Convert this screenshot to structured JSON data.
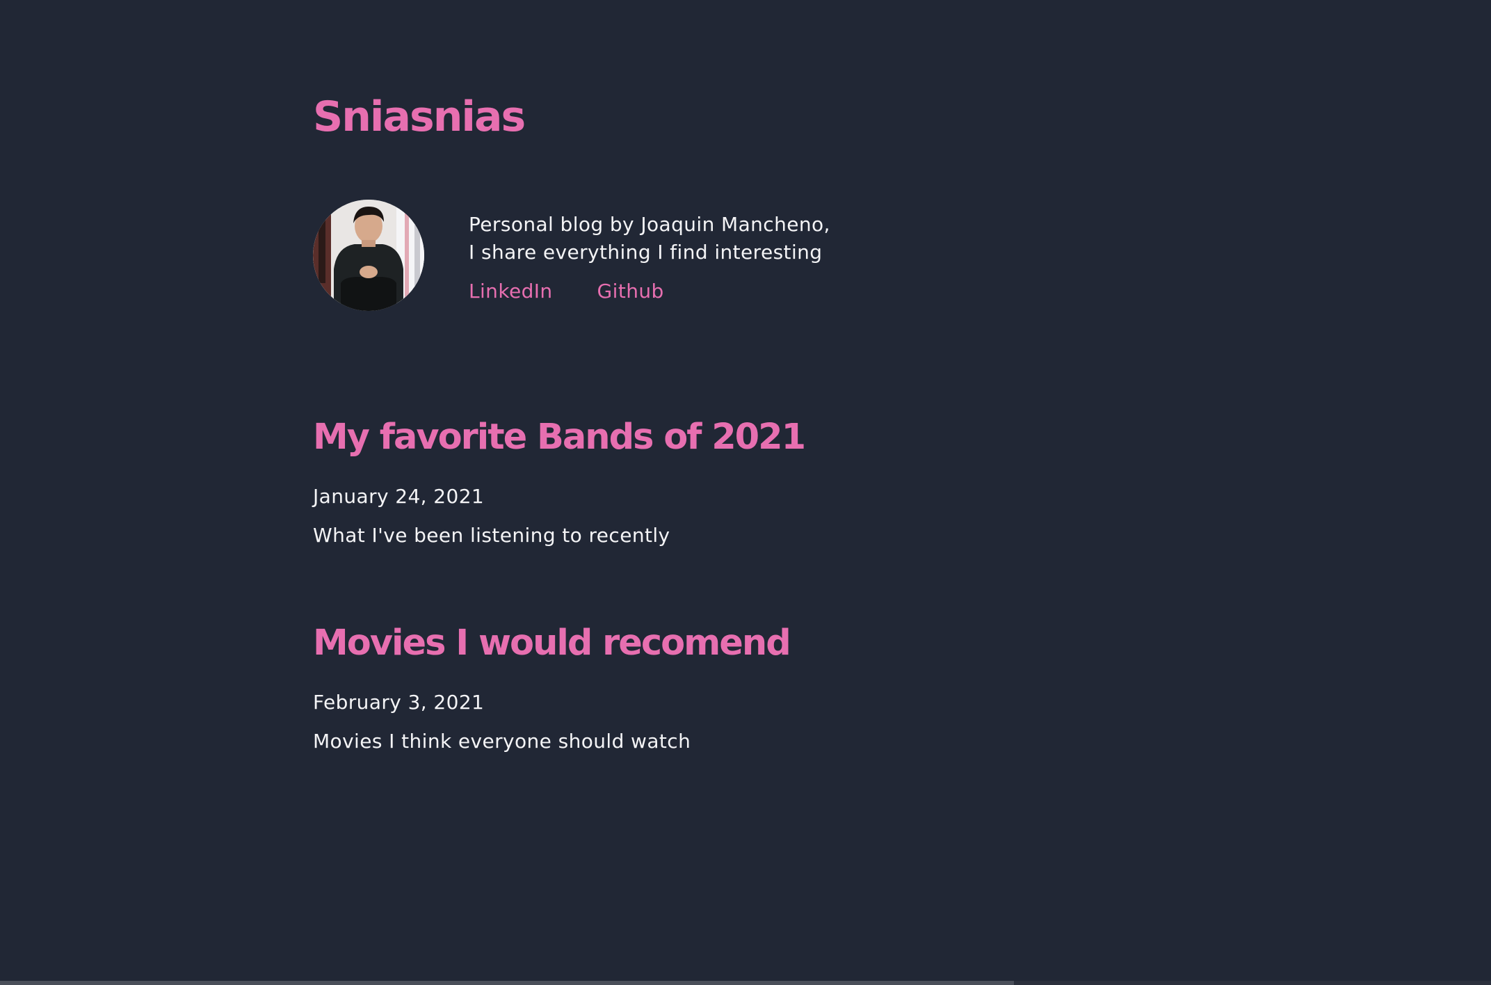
{
  "site": {
    "title": "Sniasnias"
  },
  "bio": {
    "line1": "Personal blog by Joaquin Mancheno,",
    "line2": "I share everything I find interesting",
    "avatar_icon": "profile-photo",
    "links": [
      {
        "label": "LinkedIn"
      },
      {
        "label": "Github"
      }
    ]
  },
  "posts": [
    {
      "title": "My favorite Bands of 2021",
      "date": "January 24, 2021",
      "description": "What I've been listening to recently"
    },
    {
      "title": "Movies I would recomend",
      "date": "February 3, 2021",
      "description": "Movies I think everyone should watch"
    }
  ],
  "colors": {
    "background": "#212735",
    "accent": "#e76fb0",
    "text": "#f4f4f6"
  }
}
